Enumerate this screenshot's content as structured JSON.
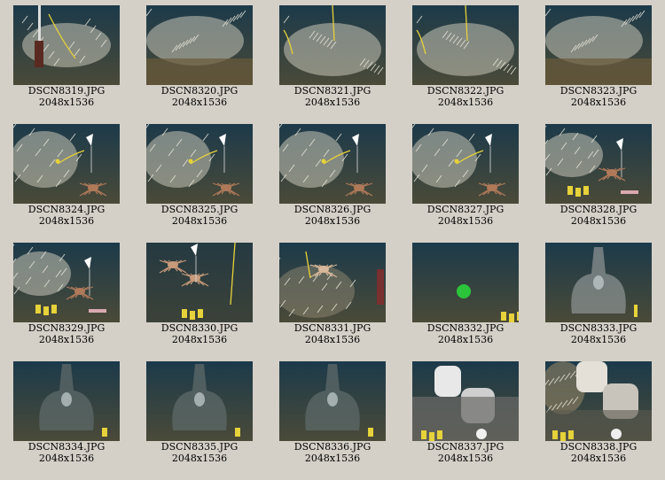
{
  "thumbnails": [
    {
      "filename": "DSCN8319.JPG",
      "dimensions": "2048x1536",
      "scene": "tubeworms-pole"
    },
    {
      "filename": "DSCN8320.JPG",
      "dimensions": "2048x1536",
      "scene": "tubeworms"
    },
    {
      "filename": "DSCN8321.JPG",
      "dimensions": "2048x1536",
      "scene": "tubeworms-cable"
    },
    {
      "filename": "DSCN8322.JPG",
      "dimensions": "2048x1536",
      "scene": "tubeworms-cable"
    },
    {
      "filename": "DSCN8323.JPG",
      "dimensions": "2048x1536",
      "scene": "tubeworms"
    },
    {
      "filename": "DSCN8324.JPG",
      "dimensions": "2048x1536",
      "scene": "crab-marker"
    },
    {
      "filename": "DSCN8325.JPG",
      "dimensions": "2048x1536",
      "scene": "crab-marker"
    },
    {
      "filename": "DSCN8326.JPG",
      "dimensions": "2048x1536",
      "scene": "crab-marker"
    },
    {
      "filename": "DSCN8327.JPG",
      "dimensions": "2048x1536",
      "scene": "crab-marker"
    },
    {
      "filename": "DSCN8328.JPG",
      "dimensions": "2048x1536",
      "scene": "crab-marker-floats"
    },
    {
      "filename": "DSCN8329.JPG",
      "dimensions": "2048x1536",
      "scene": "crab-marker-floats"
    },
    {
      "filename": "DSCN8330.JPG",
      "dimensions": "2048x1536",
      "scene": "crab-seafloor"
    },
    {
      "filename": "DSCN8331.JPG",
      "dimensions": "2048x1536",
      "scene": "crab-closeup"
    },
    {
      "filename": "DSCN8332.JPG",
      "dimensions": "2048x1536",
      "scene": "dark-green-object"
    },
    {
      "filename": "DSCN8333.JPG",
      "dimensions": "2048x1536",
      "scene": "chimney-dark"
    },
    {
      "filename": "DSCN8334.JPG",
      "dimensions": "2048x1536",
      "scene": "chimney-very-dark"
    },
    {
      "filename": "DSCN8335.JPG",
      "dimensions": "2048x1536",
      "scene": "chimney-very-dark"
    },
    {
      "filename": "DSCN8336.JPG",
      "dimensions": "2048x1536",
      "scene": "chimney-very-dark"
    },
    {
      "filename": "DSCN8337.JPG",
      "dimensions": "2048x1536",
      "scene": "chimney-bright"
    },
    {
      "filename": "DSCN8338.JPG",
      "dimensions": "2048x1536",
      "scene": "chimney-bright-worms"
    }
  ],
  "colors": {
    "page_background": "#d4d0c8",
    "ocean_deep": "#0f2a3a",
    "tubeworm": "#c9c7b8",
    "sediment": "#6a5a3a",
    "cable_yellow": "#e6d23a",
    "crab": "#b07a5a",
    "marker_white": "#ffffff",
    "green_object": "#2cc43a",
    "chimney_grey": "#8a9090"
  }
}
